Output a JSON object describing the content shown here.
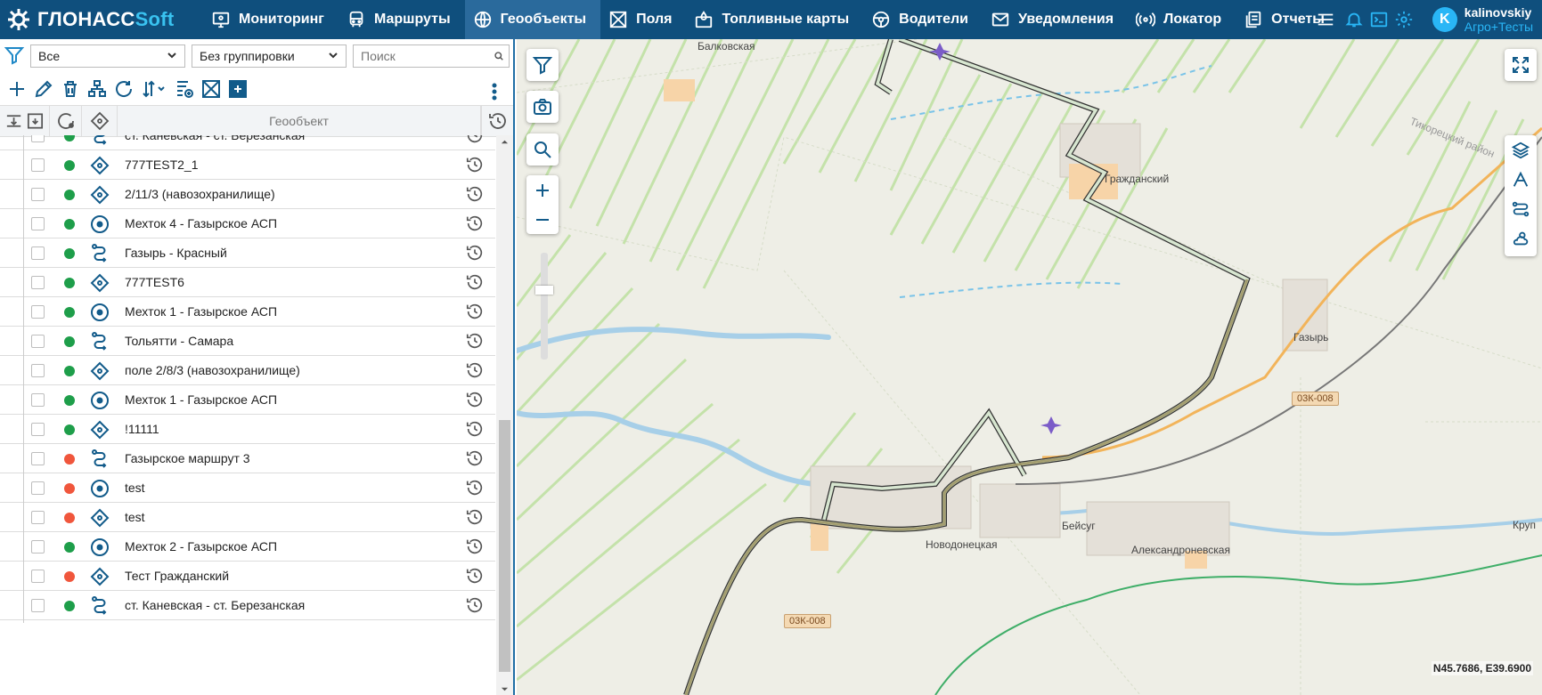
{
  "brand": {
    "name_main": "ГЛОНАСС",
    "name_soft": "Soft"
  },
  "nav": [
    {
      "label": "Мониторинг",
      "icon": "monitor-icon",
      "active": false
    },
    {
      "label": "Маршруты",
      "icon": "bus-icon",
      "active": false
    },
    {
      "label": "Геообъекты",
      "icon": "globe-icon",
      "active": true
    },
    {
      "label": "Поля",
      "icon": "field-icon",
      "active": false
    },
    {
      "label": "Топливные карты",
      "icon": "fuel-card-icon",
      "active": false
    },
    {
      "label": "Водители",
      "icon": "steering-wheel-icon",
      "active": false
    },
    {
      "label": "Уведомления",
      "icon": "mail-icon",
      "active": false
    },
    {
      "label": "Локатор",
      "icon": "locator-icon",
      "active": false
    },
    {
      "label": "Отчеты",
      "icon": "reports-icon",
      "active": false
    }
  ],
  "user": {
    "initial": "K",
    "name": "kalinovskiy",
    "org": "Агро+Тесты"
  },
  "filters": {
    "type_value": "Все",
    "grouping_value": "Без группировки",
    "search_placeholder": "Поиск"
  },
  "table": {
    "column_title": "Геообъект"
  },
  "rows": [
    {
      "name": "ст. Каневская - ст. Березанская",
      "type": "route",
      "status": "green"
    },
    {
      "name": "777TEST2_1",
      "type": "polygon",
      "status": "green"
    },
    {
      "name": "2/11/3 (навозохранилище)",
      "type": "polygon",
      "status": "green"
    },
    {
      "name": "Мехток 4 - Газырское АСП",
      "type": "circle",
      "status": "green"
    },
    {
      "name": "Газырь - Красный",
      "type": "route",
      "status": "green"
    },
    {
      "name": "777TEST6",
      "type": "polygon",
      "status": "green"
    },
    {
      "name": "Мехток 1 - Газырское АСП",
      "type": "circle",
      "status": "green"
    },
    {
      "name": "Тольятти - Самара",
      "type": "route",
      "status": "green"
    },
    {
      "name": "поле 2/8/3 (навозохранилище)",
      "type": "polygon",
      "status": "green"
    },
    {
      "name": "Мехток 1 - Газырское АСП",
      "type": "circle",
      "status": "green"
    },
    {
      "name": "!11111",
      "type": "polygon",
      "status": "green"
    },
    {
      "name": "Газырское маршрут 3",
      "type": "route",
      "status": "red"
    },
    {
      "name": "test",
      "type": "circle",
      "status": "red"
    },
    {
      "name": "test",
      "type": "polygon",
      "status": "red"
    },
    {
      "name": "Мехток 2 - Газырское АСП",
      "type": "circle",
      "status": "green"
    },
    {
      "name": "Тест Гражданский",
      "type": "polygon",
      "status": "red"
    },
    {
      "name": "ст. Каневская - ст. Березанская",
      "type": "route",
      "status": "green"
    }
  ],
  "status_colors": {
    "green": "#1e9e4a",
    "red": "#f0563c"
  },
  "map": {
    "labels": {
      "balkovskaya": "Балковская",
      "grazhdansky": "Гражданский",
      "gazyr": "Газырь",
      "novodonetskaya": "Новодонецкая",
      "beysug": "Бейсуг",
      "aleksandronevskaya": "Александроневская",
      "krup": "Круп",
      "tikhoretsky": "Тикорецкий район"
    },
    "road_badges": {
      "r1": "03К-008",
      "r2": "03К-008"
    },
    "coords": "N45.7686, E39.6900"
  }
}
